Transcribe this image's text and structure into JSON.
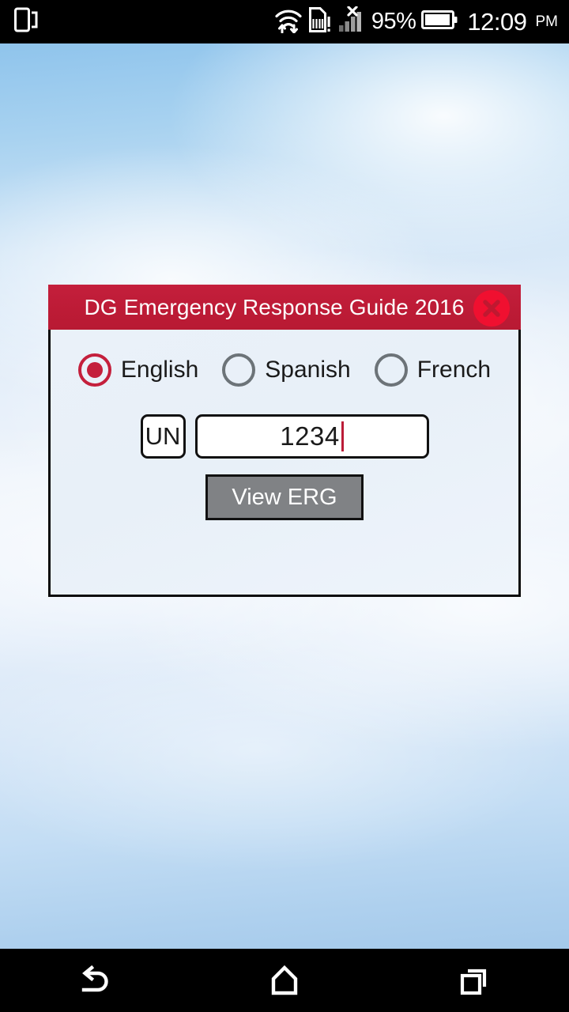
{
  "status_bar": {
    "left_icons": [
      {
        "name": "one-hand-mode-icon",
        "label": "one-hand-mode"
      }
    ],
    "right_icons": [
      {
        "name": "wifi-data-transfer-icon",
        "label": "wifi-with-updown-arrows"
      },
      {
        "name": "sim-card-alert-icon",
        "label": "sim-card-missing"
      },
      {
        "name": "no-signal-icon",
        "label": "cellular-signal-no-service"
      }
    ],
    "battery_percent": "95%",
    "battery_icon": "battery-full-icon",
    "clock_time": "12:09",
    "clock_ampm": "PM"
  },
  "dialog": {
    "title": "DG Emergency Response Guide 2016",
    "close_icon": "close-icon",
    "language": {
      "options": [
        {
          "label": "English",
          "selected": true
        },
        {
          "label": "Spanish",
          "selected": false
        },
        {
          "label": "French",
          "selected": false
        }
      ]
    },
    "un_field": {
      "prefix_label": "UN",
      "value": "1234",
      "placeholder": ""
    },
    "submit_label": "View ERG"
  },
  "nav_bar": {
    "buttons": [
      {
        "name": "nav-back-button",
        "label": "Back"
      },
      {
        "name": "nav-home-button",
        "label": "Home"
      },
      {
        "name": "nav-recents-button",
        "label": "Recent apps"
      }
    ]
  },
  "colors": {
    "brand_red": "#c41f3c",
    "close_red": "#f01030",
    "button_gray": "#808285",
    "caret_red": "#bb1c38",
    "radio_off_gray": "#6c7378"
  }
}
